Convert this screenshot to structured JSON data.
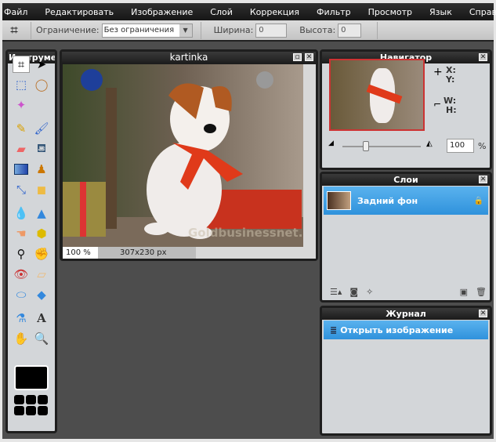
{
  "menu": [
    "Файл",
    "Редактировать",
    "Изображение",
    "Слой",
    "Коррекция",
    "Фильтр",
    "Просмотр",
    "Язык",
    "Справка"
  ],
  "toolbar": {
    "constraint_label": "Ограничение:",
    "constraint_value": "Без ограничения",
    "width_label": "Ширина:",
    "width_value": "0",
    "height_label": "Высота:",
    "height_value": "0"
  },
  "tools": {
    "title": "Инструменты"
  },
  "image_window": {
    "title": "kartinka",
    "zoom": "100 %",
    "dimensions": "307x230 px",
    "watermark": "Goldbusinessnet.com"
  },
  "navigator": {
    "title": "Навигатор",
    "x": "X:",
    "y": "Y:",
    "w": "W:",
    "h": "H:",
    "zoom_value": "100",
    "percent": "%",
    "zoom_fraction": 0.3
  },
  "layers": {
    "title": "Слои",
    "items": [
      {
        "name": "Задний фон",
        "locked": true
      }
    ]
  },
  "history": {
    "title": "Журнал",
    "items": [
      "Открыть изображение"
    ]
  },
  "colors": {
    "accent": "#3a9be2",
    "menubar": "#1e1e1e",
    "workspace": "#4d4d4d"
  }
}
